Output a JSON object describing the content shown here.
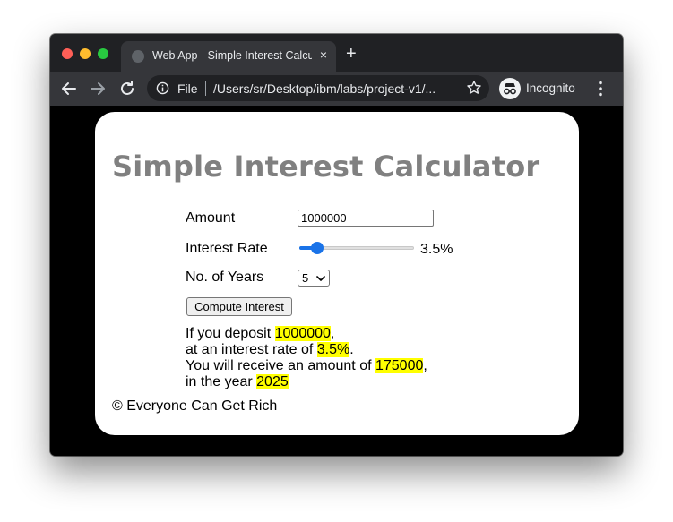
{
  "browser": {
    "tab_title": "Web App - Simple Interest Calculator",
    "tab_close": "×",
    "new_tab": "+",
    "address_scheme_label": "File",
    "address_url": "/Users/sr/Desktop/ibm/labs/project-v1/...",
    "incognito_label": "Incognito",
    "icons": [
      "back-icon",
      "forward-icon",
      "reload-icon",
      "info-icon",
      "star-icon",
      "incognito-icon",
      "menu-icon"
    ]
  },
  "page": {
    "heading": "Simple Interest Calculator",
    "form": {
      "amount_label": "Amount",
      "amount_value": "1000000",
      "rate_label": "Interest Rate",
      "rate_display": "3.5%",
      "rate_slider_fraction": 0.16,
      "years_label": "No. of Years",
      "years_selected": "5",
      "compute_button": "Compute Interest"
    },
    "result": {
      "line1_prefix": "If you deposit ",
      "deposit": "1000000",
      "line1_suffix": ",",
      "line2_prefix": "at an interest rate of ",
      "rate": "3.5%",
      "line2_suffix": ".",
      "line3_prefix": "You will receive an amount of ",
      "amount": "175000",
      "line3_suffix": ",",
      "line4_prefix": "in the year ",
      "year": "2025"
    },
    "footer": "© Everyone Can Get Rich"
  },
  "colors": {
    "accent": "#1a73e8",
    "highlight": "#ffff00",
    "heading": "#808080"
  }
}
